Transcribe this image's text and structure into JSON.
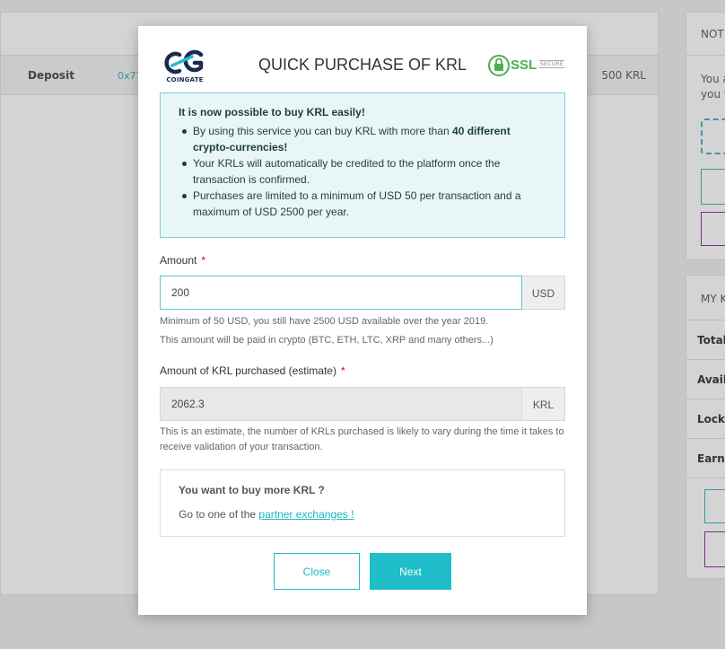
{
  "background": {
    "row": {
      "type": "Deposit",
      "address": "0x77",
      "amount": "500 KRL"
    },
    "notifications_title": "NOT",
    "notifications_text_line1": "You a",
    "notifications_text_line2": "you w",
    "holdings_title": "MY K",
    "holdings_rows": [
      "Total",
      "Availa",
      "Locke",
      "Earnin"
    ]
  },
  "modal": {
    "logo_text": "COINGATE",
    "title": "QUICK PURCHASE OF KRL",
    "ssl_label": "SSL",
    "ssl_secure": "SECURE",
    "info": {
      "title": "It is now possible to buy KRL easily!",
      "item1_prefix": "By using this service you can buy KRL with more than ",
      "item1_bold": "40 different crypto-currencies!",
      "item2": "Your KRLs will automatically be credited to the platform once the transaction is confirmed.",
      "item3": "Purchases are limited to a minimum of USD 50 per transaction and a maximum of USD 2500 per year."
    },
    "amount": {
      "label": "Amount",
      "required": "*",
      "value": "200",
      "currency": "USD",
      "help1": "Minimum of 50 USD, you still have 2500 USD available over the year 2019.",
      "help2": "This amount will be paid in crypto (BTC, ETH, LTC, XRP and many others...)"
    },
    "estimate": {
      "label": "Amount of KRL purchased (estimate)",
      "required": "*",
      "value": "2062.3",
      "currency": "KRL",
      "help": "This is an estimate, the number of KRLs purchased is likely to vary during the time it takes to receive validation of your transaction."
    },
    "buy_more": {
      "title": "You want to buy more KRL ?",
      "text": "Go to one of the ",
      "link": "partner exchanges !"
    },
    "buttons": {
      "close": "Close",
      "next": "Next"
    }
  }
}
